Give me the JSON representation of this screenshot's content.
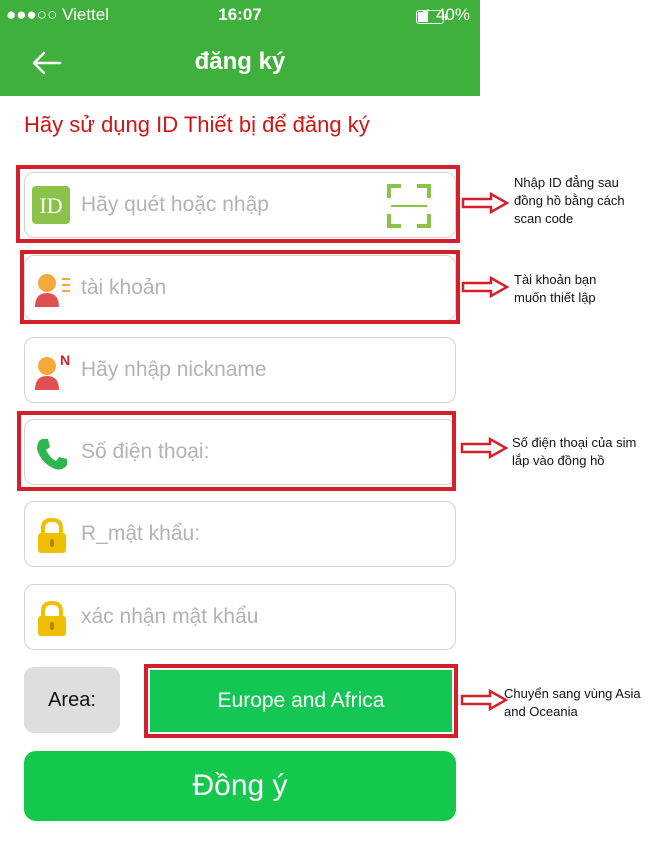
{
  "status_bar": {
    "signal": "●●●○○ Viettel",
    "time": "16:07",
    "battery": "40%",
    "battery_level": 0.4
  },
  "nav": {
    "title": "đăng ký"
  },
  "subtitle": "Hãy sử dụng ID Thiết bị để đăng ký",
  "fields": {
    "device_id": {
      "placeholder": "Hãy quét hoặc nhập",
      "icon": "ID"
    },
    "account": {
      "placeholder": "tài khoản"
    },
    "nickname": {
      "placeholder": "Hãy nhập nickname",
      "badge": "N"
    },
    "phone": {
      "placeholder": "Số điện thoại:"
    },
    "password": {
      "placeholder": "R_mật khẩu:"
    },
    "confirm_password": {
      "placeholder": "xác nhận mật khẩu"
    }
  },
  "area": {
    "label": "Area:",
    "value": "Europe and Africa"
  },
  "submit": "Đồng ý",
  "annotations": {
    "device_id": [
      "Nhập ID đẳng sau",
      "đồng hồ bằng cách",
      "scan code"
    ],
    "account": [
      "Tài khoản bạn",
      "muốn thiết lập"
    ],
    "phone": [
      "Số điện thoại của sim",
      "lắp vào đồng hồ"
    ],
    "area": [
      "Chuyển sang vùng Asia",
      "and Oceania"
    ]
  },
  "colors": {
    "green": "#3fb03b",
    "button_green": "#14c74d",
    "annotation_red": "#d4202a",
    "title_red": "#d11414"
  }
}
